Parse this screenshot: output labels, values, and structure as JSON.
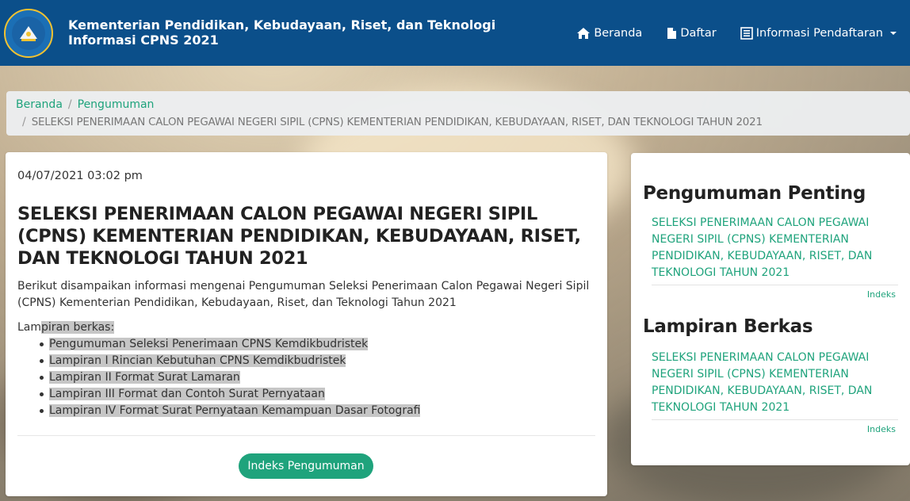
{
  "header": {
    "brand_line1": "Kementerian Pendidikan, Kebudayaan, Riset, dan Teknologi",
    "brand_line2": "Informasi CPNS 2021",
    "logo_icon": "tut-wuri-handayani-logo",
    "nav": [
      {
        "label": "Beranda",
        "icon": "home-icon"
      },
      {
        "label": "Daftar",
        "icon": "document-icon"
      },
      {
        "label": "Informasi Pendaftaran",
        "icon": "list-icon"
      }
    ]
  },
  "breadcrumb": {
    "items": [
      "Beranda",
      "Pengumuman"
    ],
    "separator": "/",
    "active": "SELEKSI PENERIMAAN CALON PEGAWAI NEGERI SIPIL (CPNS) KEMENTERIAN PENDIDIKAN, KEBUDAYAAN, RISET, DAN TEKNOLOGI TAHUN 2021"
  },
  "article": {
    "date": "04/07/2021 03:02 pm",
    "title": "SELEKSI PENERIMAAN CALON PEGAWAI NEGERI SIPIL (CPNS) KEMENTERIAN PENDIDIKAN, KEBUDAYAAN, RISET, DAN TEKNOLOGI TAHUN 2021",
    "description": "Berikut disampaikan informasi mengenai Pengumuman Seleksi Penerimaan Calon Pegawai Negeri Sipil (CPNS) Kementerian Pendidikan, Kebudayaan, Riset, dan Teknologi Tahun 2021",
    "attachments_label_a": "Lam",
    "attachments_label_b": "piran berkas:",
    "attachments": [
      "Pengumuman Seleksi Penerimaan CPNS Kemdikbudristek",
      "Lampiran I Rincian Kebutuhan CPNS Kemdikbudristek",
      "Lampiran II Format Surat Lamaran",
      "Lampiran III Format dan Contoh Surat Pernyataan",
      "Lampiran IV Format Surat Pernyataan Kemampuan Dasar Fotografi"
    ],
    "index_button": "Indeks Pengumuman"
  },
  "sidebar": {
    "important_heading": "Pengumuman Penting",
    "important_link": "SELEKSI PENERIMAAN CALON PEGAWAI NEGERI SIPIL (CPNS) KEMENTERIAN PENDIDIKAN, KEBUDAYAAN, RISET, DAN TEKNOLOGI TAHUN 2021",
    "important_index": "Indeks",
    "attachments_heading": "Lampiran Berkas",
    "attachments_link": "SELEKSI PENERIMAAN CALON PEGAWAI NEGERI SIPIL (CPNS) KEMENTERIAN PENDIDIKAN, KEBUDAYAAN, RISET, DAN TEKNOLOGI TAHUN 2021",
    "attachments_index": "Indeks"
  },
  "colors": {
    "navbar": "#0b4f8a",
    "accent": "#1fa37c",
    "highlight": "#c6c6c6"
  }
}
